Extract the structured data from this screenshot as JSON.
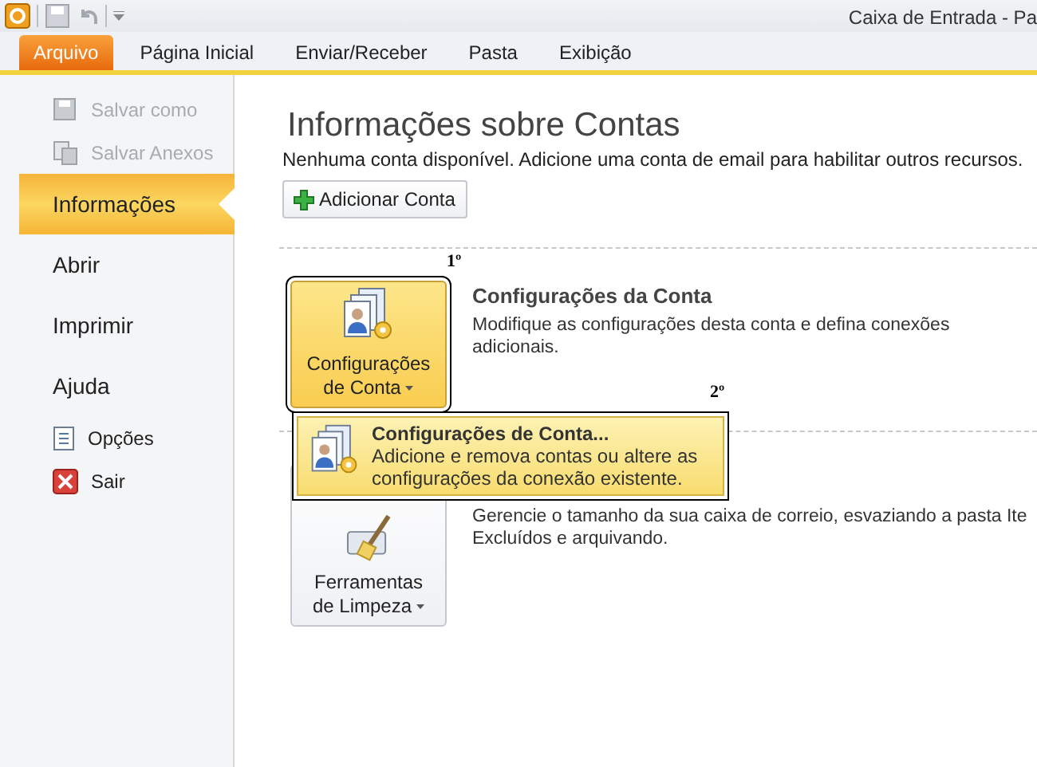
{
  "window": {
    "title": "Caixa de Entrada - Pa"
  },
  "ribbon_tabs": [
    {
      "label": "Arquivo",
      "selected": true
    },
    {
      "label": "Página Inicial",
      "selected": false
    },
    {
      "label": "Enviar/Receber",
      "selected": false
    },
    {
      "label": "Pasta",
      "selected": false
    },
    {
      "label": "Exibição",
      "selected": false
    }
  ],
  "sidebar": {
    "items": [
      {
        "label": "Salvar como",
        "kind": "command",
        "disabled": true,
        "selected": false
      },
      {
        "label": "Salvar Anexos",
        "kind": "command",
        "disabled": true,
        "selected": false
      },
      {
        "label": "Informações",
        "kind": "page",
        "disabled": false,
        "selected": true
      },
      {
        "label": "Abrir",
        "kind": "page",
        "disabled": false,
        "selected": false
      },
      {
        "label": "Imprimir",
        "kind": "page",
        "disabled": false,
        "selected": false
      },
      {
        "label": "Ajuda",
        "kind": "page",
        "disabled": false,
        "selected": false
      },
      {
        "label": "Opções",
        "kind": "command",
        "disabled": false,
        "selected": false
      },
      {
        "label": "Sair",
        "kind": "command",
        "disabled": false,
        "selected": false
      }
    ]
  },
  "info": {
    "title": "Informações sobre Contas",
    "subtitle": "Nenhuma conta disponível. Adicione uma conta de email para habilitar outros recursos.",
    "add_button": "Adicionar Conta"
  },
  "sections": [
    {
      "button_lines": [
        "Configurações",
        "de Conta"
      ],
      "highlighted": true,
      "marker": "1º",
      "heading": "Configurações da Conta",
      "description": "Modifique as configurações desta conta e defina conexões\nadicionais."
    },
    {
      "button_lines": [
        "Ferramentas",
        "de Limpeza"
      ],
      "highlighted": false,
      "description": "Gerencie o tamanho da sua caixa de correio, esvaziando a pasta Ite\nExcluídos e arquivando."
    }
  ],
  "dropdown_menu": {
    "marker": "2º",
    "items": [
      {
        "title": "Configurações de Conta...",
        "description": "Adicione e remova contas ou altere as configurações da conexão existente.",
        "selected": true
      }
    ]
  }
}
